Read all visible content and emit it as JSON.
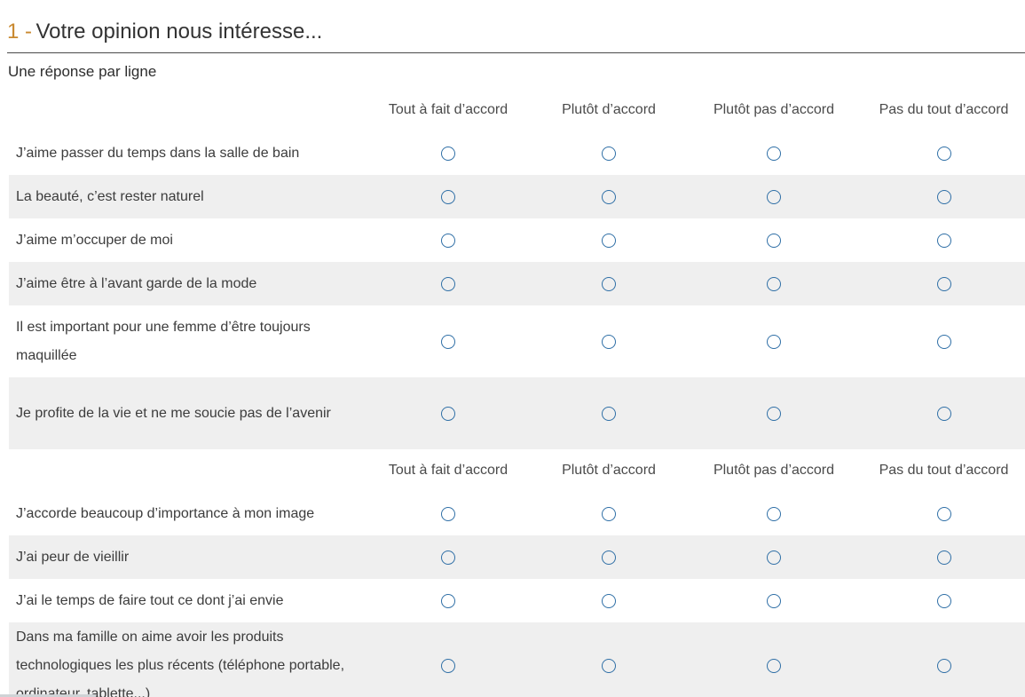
{
  "question": {
    "number": "1 -",
    "title": "Votre opinion nous intéresse..."
  },
  "instruction": "Une réponse par ligne",
  "columns": [
    "Tout à fait d’accord",
    "Plutôt d’accord",
    "Plutôt pas d’accord",
    "Pas du tout d’accord"
  ],
  "statements": [
    "J’aime passer du temps dans la salle de bain",
    "La beauté, c’est rester naturel",
    "J’aime m’occuper de moi",
    "J’aime être à l’avant garde de la mode",
    "Il est important pour une femme d’être toujours maquillée",
    "Je profite de la vie et ne me soucie pas de l’avenir",
    "J’accorde beaucoup d’importance à mon image",
    "J’ai peur de vieillir",
    "J’ai le temps de faire tout ce dont j’ai envie",
    "Dans ma famille on aime avoir les produits technologiques les plus récents (téléphone portable, ordinateur, tablette...)"
  ],
  "colors": {
    "accent": "#c9892f",
    "radio": "#2f6fa6",
    "row_alt": "#efefef"
  }
}
